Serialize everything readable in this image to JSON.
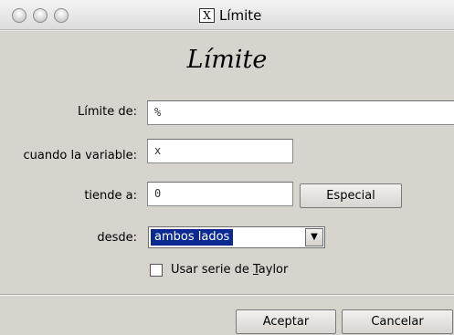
{
  "window": {
    "title": "Límite",
    "x11_icon_text": "X"
  },
  "dialog": {
    "heading": "Límite",
    "fields": {
      "limit_of": {
        "label": "Límite de:",
        "value": "%"
      },
      "variable": {
        "label": "cuando la variable:",
        "value": "x"
      },
      "tends_to": {
        "label": "tiende a:",
        "value": "0"
      }
    },
    "special_button": "Especial",
    "direction": {
      "label": "desde:",
      "selected": "ambos lados"
    },
    "taylor": {
      "label_before": "Usar serie de ",
      "label_underlined": "T",
      "label_after": "aylor",
      "checked": false
    },
    "buttons": {
      "accept": "Aceptar",
      "cancel": "Cancelar"
    }
  }
}
